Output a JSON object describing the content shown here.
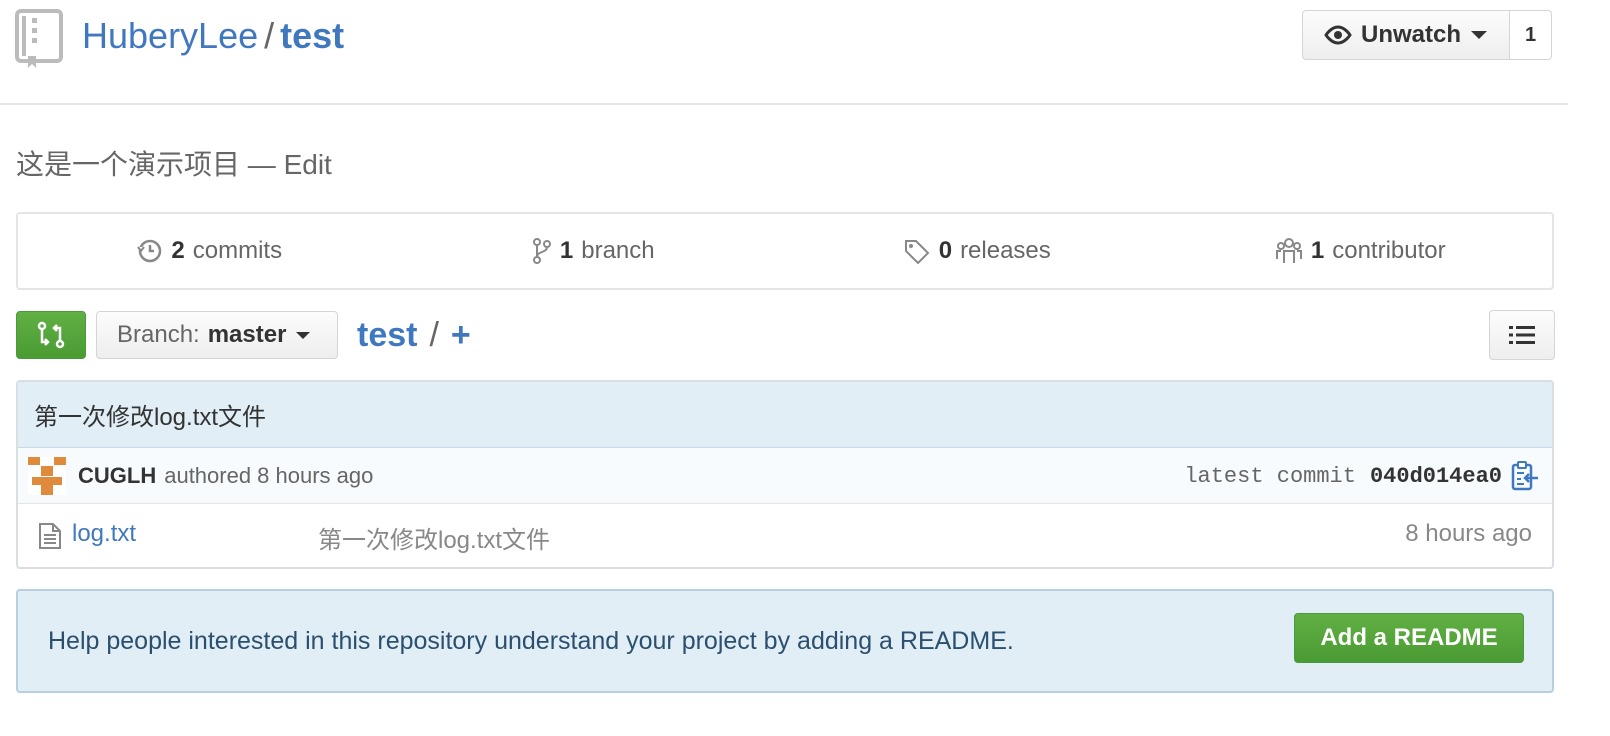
{
  "repo": {
    "owner": "HuberyLee",
    "separator": "/",
    "name": "test",
    "description": "这是一个演示项目",
    "description_dash": "—",
    "edit_label": "Edit"
  },
  "watch": {
    "label": "Unwatch",
    "count": "1"
  },
  "summary": {
    "commits_count": "2",
    "commits_label": "commits",
    "branches_count": "1",
    "branches_label": "branch",
    "releases_count": "0",
    "releases_label": "releases",
    "contributors_count": "1",
    "contributors_label": "contributor"
  },
  "toolbar": {
    "branch_prefix": "Branch:",
    "branch_name": "master",
    "breadcrumb_root": "test",
    "breadcrumb_sep": "/",
    "breadcrumb_add": "+"
  },
  "last_commit": {
    "message": "第一次修改log.txt文件",
    "author": "CUGLH",
    "authored": "authored 8 hours ago",
    "latest_label": "latest commit",
    "sha": "040d014ea0"
  },
  "files": [
    {
      "name": "log.txt",
      "message": "第一次修改log.txt文件",
      "age": "8 hours ago"
    }
  ],
  "readme": {
    "text": "Help people interested in this repository understand your project by adding a README.",
    "button": "Add a README"
  },
  "colors": {
    "link": "#4078c0",
    "green": "#55a532",
    "blue_banner": "#e1eef6"
  },
  "icons": {
    "repo": "repo-icon",
    "eye": "eye-icon",
    "commits": "history-icon",
    "branch": "git-branch-icon",
    "releases": "tag-icon",
    "contributors": "organization-icon",
    "compare": "git-compare-icon",
    "list": "list-unordered-icon",
    "file": "file-text-icon",
    "clipboard": "clippy-icon"
  }
}
